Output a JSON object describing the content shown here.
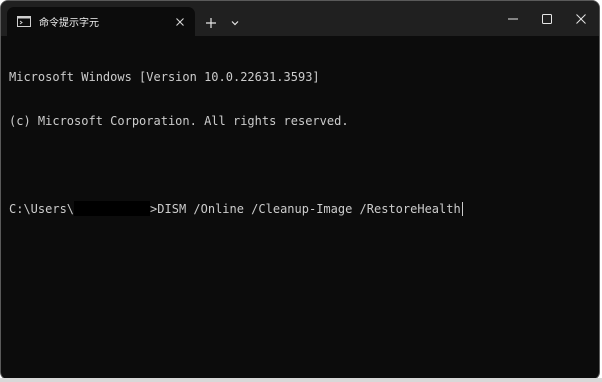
{
  "window": {
    "tab_title": "命令提示字元",
    "tab_icon": "terminal-icon",
    "new_tab_symbol": "+",
    "dropdown_icon": "chevron-down-icon",
    "close_tab_icon": "close-icon",
    "minimize_icon": "minimize-icon",
    "maximize_icon": "maximize-icon",
    "close_window_icon": "close-icon"
  },
  "terminal": {
    "lines": [
      "Microsoft Windows [Version 10.0.22631.3593]",
      "(c) Microsoft Corporation. All rights reserved."
    ],
    "prompt_prefix": "C:\\Users\\",
    "prompt_suffix": ">",
    "command": "DISM /Online /Cleanup-Image /RestoreHealth"
  },
  "colors": {
    "terminal_background": "#0c0c0c",
    "titlebar_background": "#202020",
    "text": "#cccccc"
  }
}
